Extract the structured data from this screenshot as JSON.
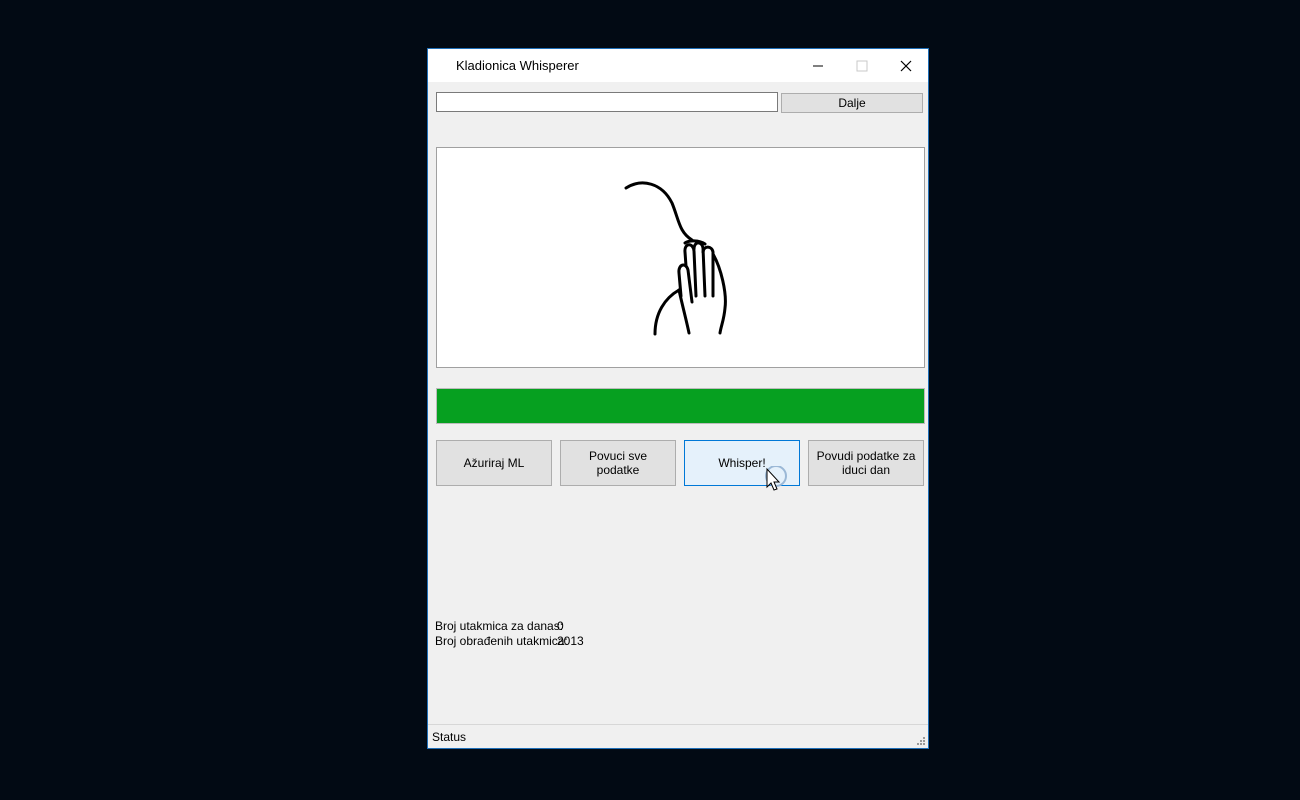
{
  "window": {
    "title": "Kladionica Whisperer",
    "controls": {
      "minimize": "—",
      "maximize": "☐",
      "close": "✕"
    }
  },
  "toolbar": {
    "url_value": "",
    "next_label": "Dalje"
  },
  "picture": {
    "icon": "hand-whisper-icon"
  },
  "progress": {
    "fraction": 1.0,
    "color": "#06a020"
  },
  "buttons": {
    "update_ml": "Ažuriraj ML",
    "pull_all": "Povuci sve podatke",
    "whisper": "Whisper!",
    "pull_next_day": "Povudi podatke za iduci dan"
  },
  "stats": {
    "today_label": "Broj utakmica za danas:",
    "today_value": "0",
    "processed_label": "Broj obrađenih utakmica:",
    "processed_value": "2013"
  },
  "statusbar": {
    "text": "Status"
  }
}
